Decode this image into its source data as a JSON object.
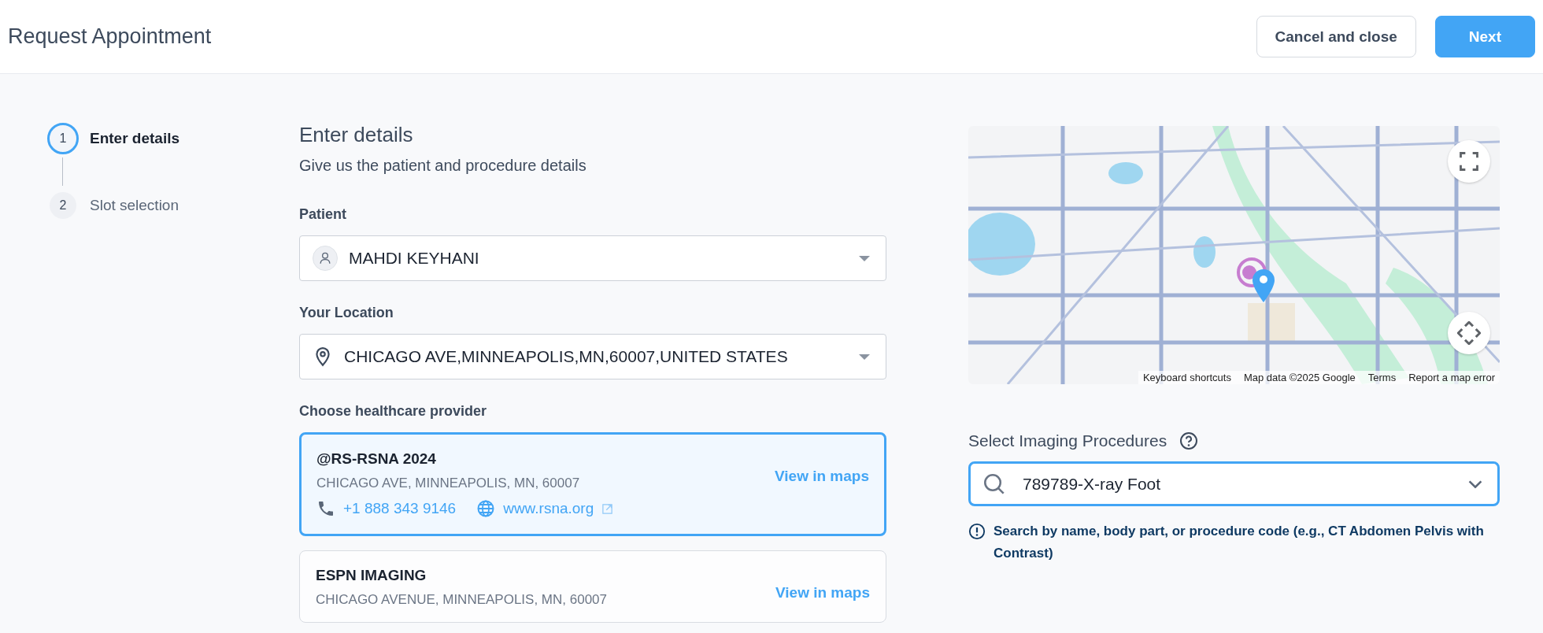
{
  "header": {
    "title": "Request Appointment",
    "buttons": [
      {
        "label": "Cancel and close",
        "kind": "secondary"
      },
      {
        "label": "Next",
        "kind": "primary"
      }
    ]
  },
  "steps": [
    {
      "number": "1",
      "label": "Enter details",
      "selected": true
    },
    {
      "number": "2",
      "label": "Slot selection",
      "selected": false
    }
  ],
  "form": {
    "heading": "Enter details",
    "subtitle": "Give us the patient and procedure details",
    "fields": [
      {
        "label": "Patient",
        "kind": "person",
        "value": "MAHDI KEYHANI"
      },
      {
        "label": "Your Location",
        "kind": "location",
        "value": "CHICAGO AVE,MINNEAPOLIS,MN,60007,UNITED STATES"
      }
    ],
    "provider_label": "Choose healthcare provider",
    "providers": [
      {
        "name": "@RS-RSNA 2024",
        "address": "CHICAGO AVE, MINNEAPOLIS, MN, 60007",
        "phone": "+1 888 343 9146",
        "website": "www.rsna.org",
        "link": "View in maps",
        "selected": true
      },
      {
        "name": "ESPN IMAGING",
        "address": "CHICAGO AVENUE, MINNEAPOLIS, MN, 60007",
        "link": "View in maps",
        "selected": false
      }
    ]
  },
  "map": {
    "kind": "picture",
    "attribution": [
      "Keyboard shortcuts",
      "Map data ©2025 Google",
      "Terms",
      "Report a map error"
    ]
  },
  "procedures": {
    "label": "Select Imaging Procedures",
    "value": "789789-X-ray Foot",
    "hint": "Search by name, body part, or procedure code (e.g., CT Abdomen Pelvis with Contrast)"
  }
}
